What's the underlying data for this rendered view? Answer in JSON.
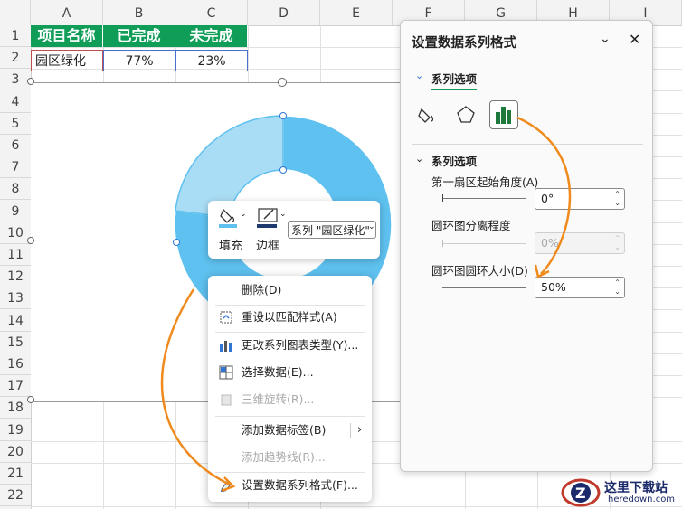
{
  "columns": [
    "A",
    "B",
    "C",
    "D",
    "E",
    "F",
    "G",
    "H",
    "I"
  ],
  "rows": [
    "1",
    "2",
    "3",
    "4",
    "5",
    "6",
    "7",
    "8",
    "9",
    "10",
    "11",
    "12",
    "13",
    "14",
    "15",
    "16",
    "17",
    "18",
    "19",
    "20",
    "21",
    "22"
  ],
  "table": {
    "headers": [
      "项目名称",
      "已完成",
      "未完成"
    ],
    "row2": [
      "园区绿化",
      "77%",
      "23%"
    ]
  },
  "chart_data": {
    "type": "pie",
    "categories": [
      "已完成",
      "未完成"
    ],
    "values": [
      77,
      23
    ],
    "hole": 0.5,
    "colors": [
      "#5ec1ef",
      "#a9dcf5"
    ]
  },
  "mini_toolbar": {
    "fill_label": "填充",
    "border_label": "边框",
    "series_select": "系列 \"园区绿化\""
  },
  "context_menu": {
    "items": [
      {
        "label": "删除(D)",
        "icon": "none"
      },
      {
        "label": "重设以匹配样式(A)",
        "icon": "reset-icon"
      },
      {
        "label": "更改系列图表类型(Y)...",
        "icon": "chart-type-icon"
      },
      {
        "label": "选择数据(E)...",
        "icon": "select-data-icon"
      },
      {
        "label": "三维旋转(R)...",
        "icon": "rotate-3d-icon"
      },
      {
        "label": "添加数据标签(B)",
        "icon": "none"
      },
      {
        "label": "添加趋势线(R)...",
        "icon": "none"
      },
      {
        "label": "设置数据系列格式(F)...",
        "icon": "format-series-icon"
      }
    ]
  },
  "pane": {
    "title": "设置数据系列格式",
    "tab": "系列选项",
    "section": "系列选项",
    "angle_label": "第一扇区起始角度(A)",
    "angle_value": "0°",
    "explode_label": "圆环图分离程度",
    "explode_value": "0%",
    "hole_label": "圆环图圆环大小(D)",
    "hole_value": "50%",
    "accent": "#0f9d58",
    "arrow_color": "#f08a1c"
  },
  "watermark": {
    "title": "这里下载站",
    "url": "heredown.com"
  }
}
